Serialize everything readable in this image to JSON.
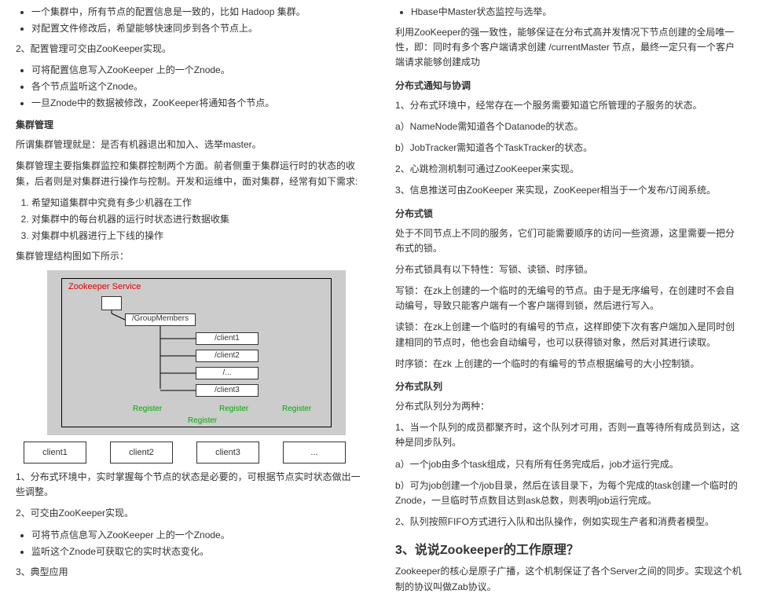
{
  "left": {
    "top_list": [
      "一个集群中，所有节点的配置信息是一致的，比如 Hadoop 集群。",
      "对配置文件修改后，希望能够快速同步到各个节点上。"
    ],
    "line2": "2、配置管理可交由ZooKeeper实现。",
    "list2": [
      "可将配置信息写入ZooKeeper 上的一个Znode。",
      "各个节点监听这个Znode。",
      "一旦Znode中的数据被修改，ZooKeeper将通知各个节点。"
    ],
    "h_cluster": "集群管理",
    "p_cluster1": "所谓集群管理就是：是否有机器退出和加入、选举master。",
    "p_cluster2": "集群管理主要指集群监控和集群控制两个方面。前者侧重于集群运行时的状态的收集，后者则是对集群进行操作与控制。开发和运维中，面对集群，经常有如下需求:",
    "ol_cluster": [
      "希望知道集群中究竟有多少机器在工作",
      "对集群中的每台机器的运行时状态进行数据收集",
      "对集群中机器进行上下线的操作"
    ],
    "p_struct": "集群管理结构图如下所示：",
    "diag": {
      "title": "Zookeeper Service",
      "gm": "/GroupMembers",
      "c1": "/client1",
      "c2": "/client2",
      "dots": "/...",
      "c3": "/client3",
      "reg": "Register"
    },
    "clients": [
      "client1",
      "client2",
      "client3",
      "..."
    ],
    "p_after1": "1、分布式环境中，实时掌握每个节点的状态是必要的，可根据节点实时状态做出一些调整。",
    "p_after2": "2、可交由ZooKeeper实现。",
    "list_after": [
      "可将节点信息写入ZooKeeper 上的一个Znode。",
      "监听这个Znode可获取它的实时状态变化。"
    ],
    "p_after3": "3、典型应用"
  },
  "right": {
    "top_list": [
      "Hbase中Master状态监控与选举。"
    ],
    "p_r1": "利用ZooKeeper的强一致性，能够保证在分布式高并发情况下节点创建的全局唯一性，即：同时有多个客户端请求创建 /currentMaster 节点，最终一定只有一个客户端请求能够创建成功",
    "h_notify": "分布式通知与协调",
    "p_n1": "1、分布式环境中，经常存在一个服务需要知道它所管理的子服务的状态。",
    "p_na": "a）NameNode需知道各个Datanode的状态。",
    "p_nb": "b）JobTracker需知道各个TaskTracker的状态。",
    "p_n2": "2、心跳检测机制可通过ZooKeeper来实现。",
    "p_n3": "3、信息推送可由ZooKeeper 来实现，ZooKeeper相当于一个发布/订阅系统。",
    "h_lock": "分布式锁",
    "p_l1": "处于不同节点上不同的服务，它们可能需要顺序的访问一些资源，这里需要一把分布式的锁。",
    "p_l2": "分布式锁具有以下特性：写锁、读锁、时序锁。",
    "p_l3": "写锁：在zk上创建的一个临时的无编号的节点。由于是无序编号，在创建时不会自动编号，导致只能客户端有一个客户端得到锁，然后进行写入。",
    "p_l4": "读锁：在zk上创建一个临时的有编号的节点，这样即使下次有客户端加入是同时创建相同的节点时，他也会自动编号，也可以获得锁对象，然后对其进行读取。",
    "p_l5": "时序锁：在zk 上创建的一个临时的有编号的节点根据编号的大小控制锁。",
    "h_queue": "分布式队列",
    "p_q1": "分布式队列分为两种：",
    "p_q2": "1、当一个队列的成员都聚齐时，这个队列才可用，否则一直等待所有成员到达，这种是同步队列。",
    "p_qa": "a）一个job由多个task组成，只有所有任务完成后，job才运行完成。",
    "p_qb": "b）可为job创建一个/job目录，然后在该目录下，为每个完成的task创建一个临时的Znode，一旦临时节点数目达到ask总数，则表明job运行完成。",
    "p_q3": "2、队列按照FIFO方式进行入队和出队操作，例如实现生产者和消费者模型。",
    "h3": "3、说说Zookeeper的工作原理？",
    "p_work": "Zookeeper的核心是原子广播，这个机制保证了各个Server之间的同步。实现这个机制的协议叫做Zab协议。"
  }
}
